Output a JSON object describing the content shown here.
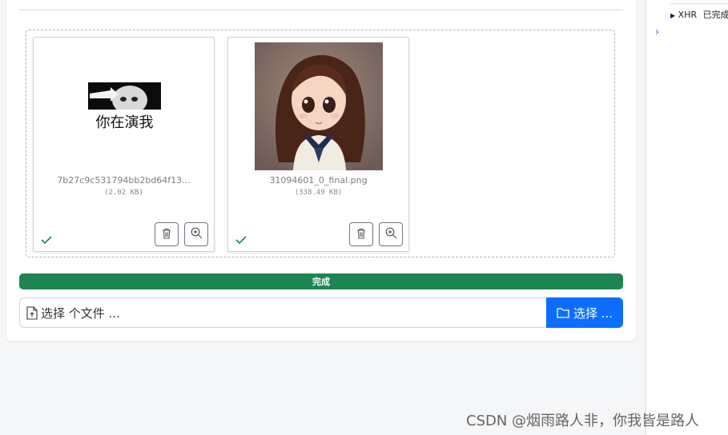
{
  "files": [
    {
      "name": "7b27c9c531794bb2bd64f13...",
      "size": "(2.02 KB)",
      "image_text": "你在演我"
    },
    {
      "name": "31094601_0_final.png",
      "size": "(338.49 KB)"
    }
  ],
  "progress": {
    "label": "完成",
    "percent": 100
  },
  "file_input": {
    "caption": "选择 个文件 ...",
    "browse_label": "选择 ..."
  },
  "devtools": {
    "request_type": "XHR",
    "request_status": "已完成"
  },
  "watermark": "CSDN @烟雨路人非，你我皆是路人",
  "colors": {
    "progress_bar": "#1e8452",
    "browse_button": "#0d6efd",
    "success_check": "#1e8452"
  }
}
